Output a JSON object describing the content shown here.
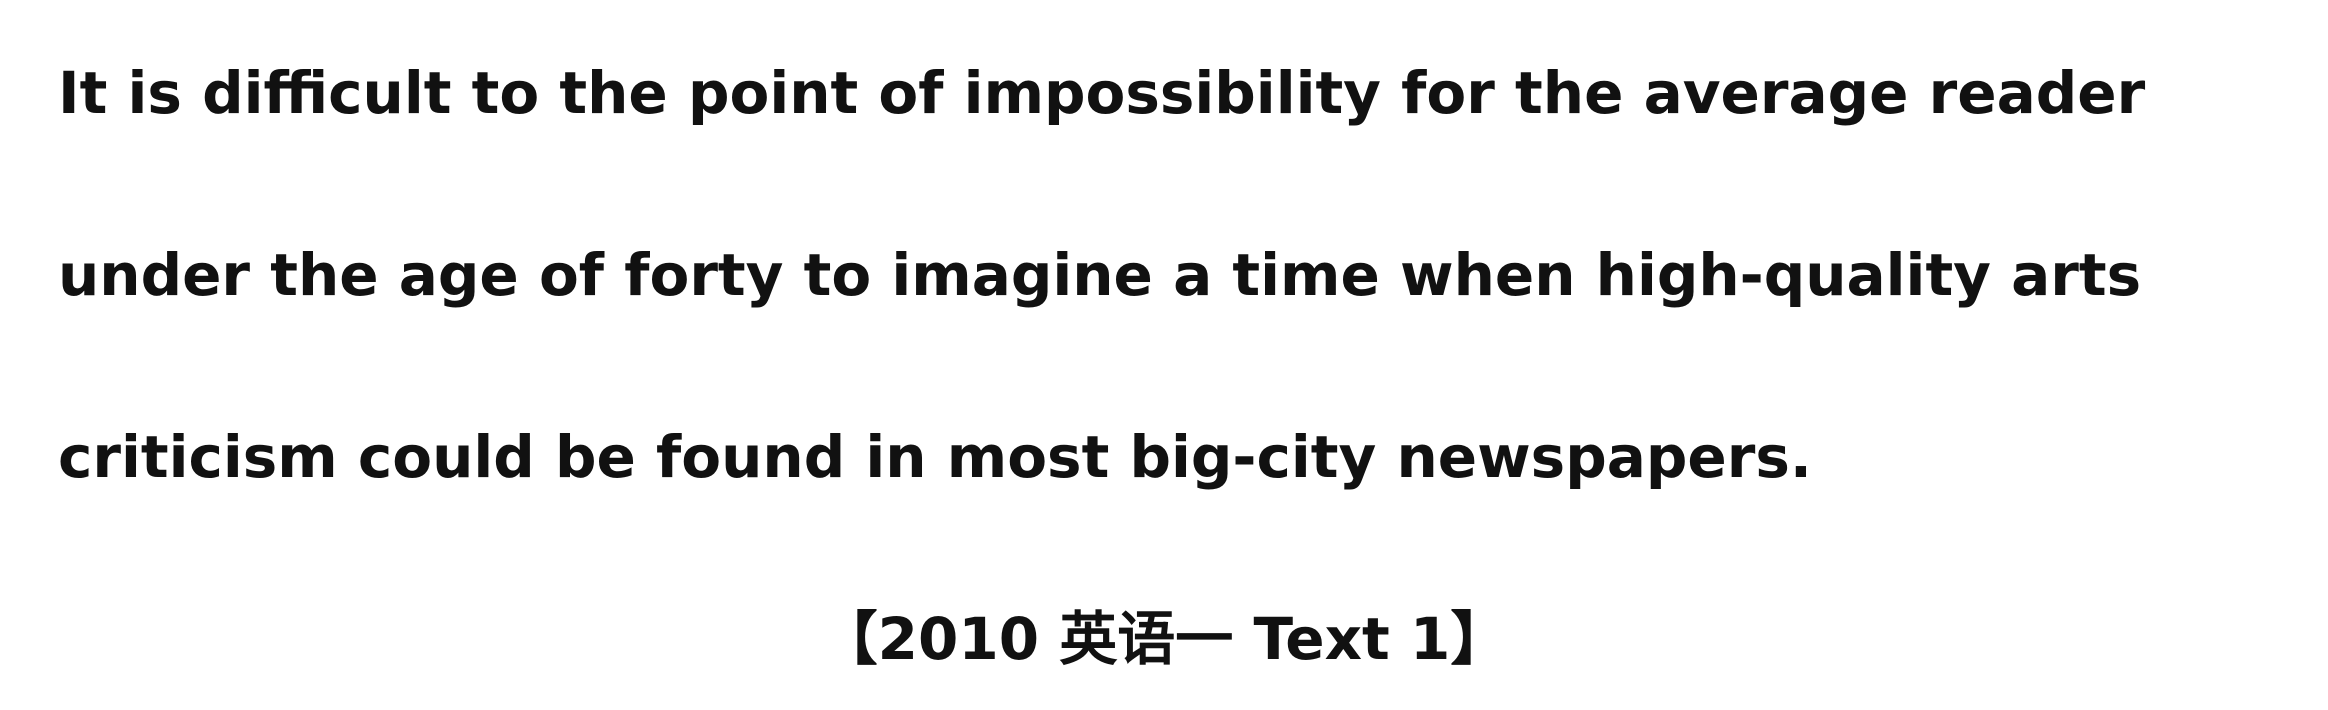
{
  "passage": {
    "lines": [
      "It is difficult to the point of impossibility for the average reader",
      "under the age of forty to imagine a time when high-quality arts",
      "criticism could be found in most big-city newspapers."
    ]
  },
  "source_label": "【2010 英语一 Text 1】"
}
